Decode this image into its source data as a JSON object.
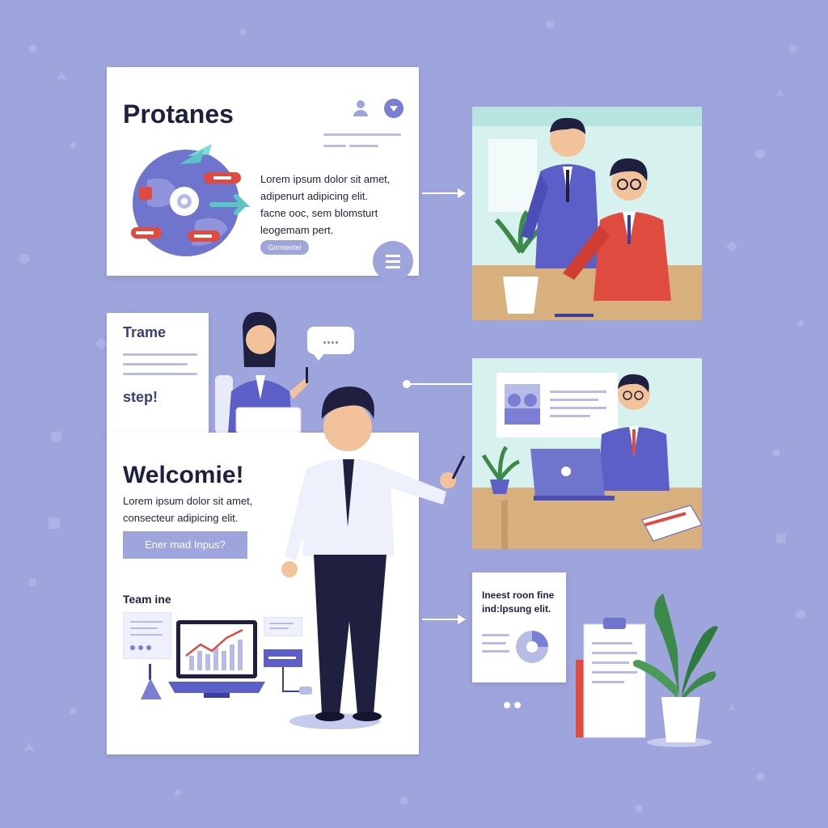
{
  "card_top": {
    "title": "Protanes",
    "body": "Lorem ipsum dolor sit amet,\nadipenurt adipicing elit.\nfacne ooc, sem blomsturt\nleogemam pert.",
    "button": "Gonsentel",
    "user_icon": "user-icon",
    "dropdown_icon": "chevron-down-icon",
    "menu_icon": "menu-icon"
  },
  "card_side": {
    "title": "Trame",
    "subtitle": "step!"
  },
  "card_main": {
    "title": "Welcomie!",
    "body": "Lorem ipsum dolor sit amet,\nconsecteur adipicing elit.",
    "button": "Ener rnad Inpus?",
    "section_label": "Team ine"
  },
  "card_small": {
    "text": "Ineest roon fine\nind:lpsung elit."
  },
  "speech_bubble": "....",
  "colors": {
    "background": "#9ea4dc",
    "accent": "#5b5fc7",
    "accent_light": "#b7bce6",
    "red": "#e04b3f",
    "navy": "#1f2040"
  }
}
